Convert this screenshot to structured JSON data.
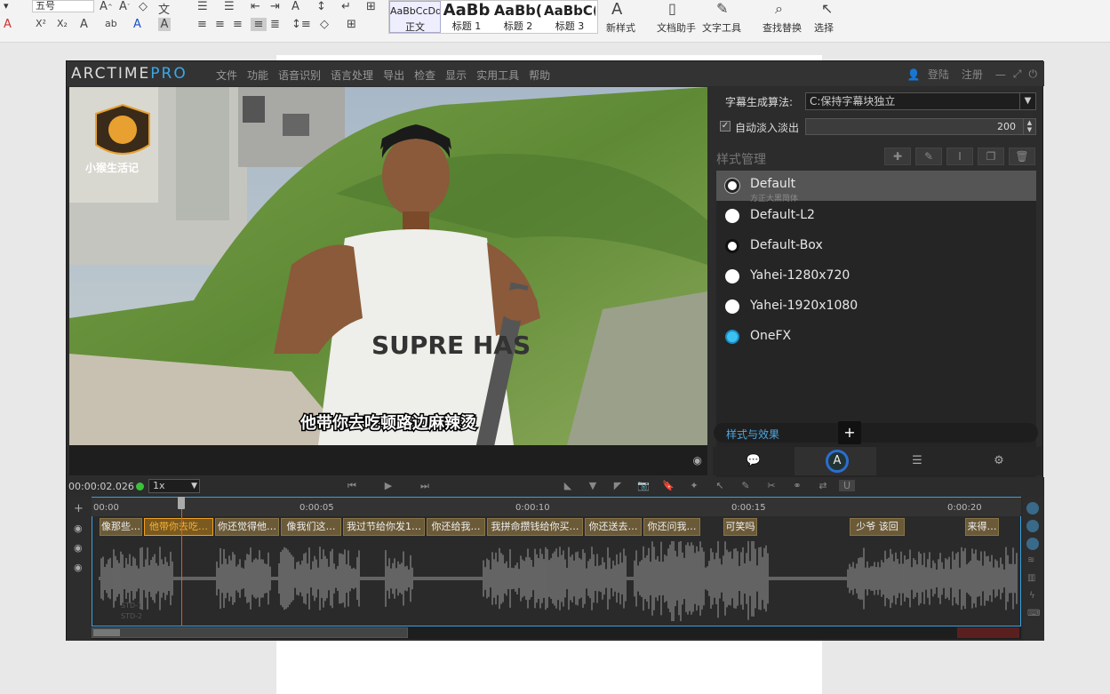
{
  "ribbon": {
    "font_size_value": "五号",
    "styles": [
      {
        "preview": "AaBbCcDd",
        "label": "正文"
      },
      {
        "preview": "AaBb",
        "label": "标题 1"
      },
      {
        "preview": "AaBb(",
        "label": "标题 2"
      },
      {
        "preview": "AaBbC(",
        "label": "标题 3"
      }
    ],
    "new_style": "新样式",
    "doc_helper": "文档助手",
    "text_tools": "文字工具",
    "find_replace": "查找替换",
    "select": "选择",
    "icon_names": [
      "grow-font-icon",
      "shrink-font-icon",
      "clear-format-icon",
      "bold-icon",
      "align-left-icon",
      "align-center-icon",
      "align-right-icon",
      "justify-icon",
      "find-icon",
      "select-cursor-icon"
    ]
  },
  "app": {
    "logo_main": "ARCTIME",
    "logo_pro": "PRO",
    "menu": [
      "文件",
      "功能",
      "语音识别",
      "语言处理",
      "导出",
      "检查",
      "显示",
      "实用工具",
      "帮助"
    ],
    "login": "登陆",
    "register": "注册"
  },
  "video": {
    "watermark_text": "小猴生活记",
    "subtitle": "他带你去吃顿路边麻辣烫",
    "shirt_text": "SUPRE HAS"
  },
  "panel": {
    "algo_label": "字幕生成算法:",
    "algo_value": "C:保持字幕块独立",
    "fade_label": "自动淡入淡出",
    "fade_value": "200",
    "style_mgmt_title": "样式管理",
    "styles": [
      {
        "name": "Default",
        "sub": "方正大黑简体",
        "selected": true
      },
      {
        "name": "Default-L2",
        "sub": ""
      },
      {
        "name": "Default-Box",
        "sub": ""
      },
      {
        "name": "Yahei-1280x720",
        "sub": ""
      },
      {
        "name": "Yahei-1920x1080",
        "sub": ""
      },
      {
        "name": "OneFX",
        "sub": ""
      }
    ],
    "fx_tab_label": "样式与效果",
    "fx_plus": "+"
  },
  "timeline": {
    "time": "00:00:02.026",
    "speed": "1x",
    "ticks": [
      "00:00",
      "0:00:05",
      "0:00:10",
      "0:00:15",
      "0:00:20"
    ],
    "subtitles": [
      {
        "text": "像那些…",
        "active": false
      },
      {
        "text": "他带你去吃…",
        "active": true
      },
      {
        "text": "你还觉得他…",
        "active": false
      },
      {
        "text": "像我们这…",
        "active": false
      },
      {
        "text": "我过节给你发1…",
        "active": false
      },
      {
        "text": "你还给我…",
        "active": false
      },
      {
        "text": "我拼命攒钱给你买…",
        "active": false
      },
      {
        "text": "你还送去…",
        "active": false
      },
      {
        "text": "你还问我…",
        "active": false
      },
      {
        "text": "可笑吗",
        "active": false
      },
      {
        "text": "少爷 该回",
        "active": false
      },
      {
        "text": "来得…",
        "active": false
      }
    ]
  }
}
